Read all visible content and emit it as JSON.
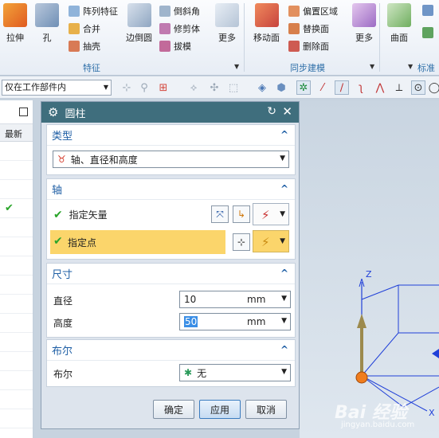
{
  "ribbon": {
    "extrude": "拉伸",
    "hole": "孔",
    "pattern_feature": "阵列特征",
    "unite": "合并",
    "shell": "抽壳",
    "edge_blend": "边倒圆",
    "chamfer": "倒斜角",
    "trim_body": "修剪体",
    "draft": "拔模",
    "more1": "更多",
    "group_feature": "特征",
    "move_face": "移动面",
    "offset_region": "偏置区域",
    "replace_face": "替换面",
    "delete_face": "删除面",
    "more2": "更多",
    "group_sync": "同步建模",
    "surface": "曲面",
    "group_std": "标准件"
  },
  "toolbar2": {
    "filter_value": "仅在工作部件内"
  },
  "left_panel": {
    "column_header": "最新"
  },
  "dialog": {
    "title": "圆柱",
    "type_section": "类型",
    "type_value": "轴、直径和高度",
    "axis_section": "轴",
    "specify_vector": "指定矢量",
    "specify_point": "指定点",
    "dimensions_section": "尺寸",
    "diameter_label": "直径",
    "diameter_value": "10",
    "diameter_unit": "mm",
    "height_label": "高度",
    "height_value": "50",
    "height_unit": "mm",
    "boolean_section": "布尔",
    "boolean_label": "布尔",
    "boolean_value": "无",
    "ok": "确定",
    "apply": "应用",
    "cancel": "取消"
  },
  "viewport": {
    "axis_z": "Z",
    "axis_x": "X"
  },
  "watermark": {
    "text": "Bai 经验",
    "url": "jingyan.baidu.com"
  },
  "colors": {
    "title_bar": "#3f6e7d",
    "section_heading": "#1f5fa5",
    "highlight_row": "#fbd56b",
    "check_green": "#2aa52a"
  }
}
